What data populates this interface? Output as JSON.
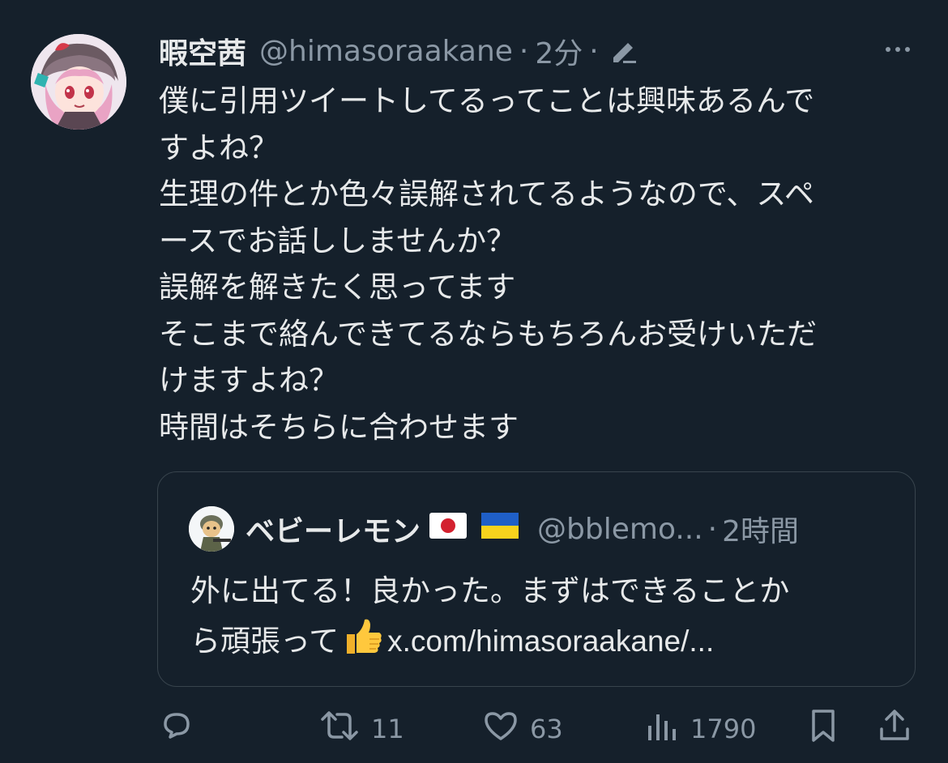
{
  "tweet": {
    "author_name": "暇空茜",
    "handle": "@himasoraakane",
    "separator": "·",
    "time": "2分",
    "separator2": "·",
    "lines": [
      "僕に引用ツイートしてるってことは興味あるんで",
      "すよね？",
      "生理の件とか色々誤解されてるようなので、スペ",
      "ースでお話ししませんか？",
      "誤解を解きたく思ってます",
      "そこまで絡んできてるならもちろんお受けいただ",
      "けますよね？",
      "時間はそちらに合わせます"
    ]
  },
  "quote": {
    "author_name": "ベビーレモン",
    "handle": "@bblemo...",
    "separator": "·",
    "time": "2時間",
    "line1": "外に出てる！良かった。まずはできることか",
    "line2_prefix": "ら頑張って",
    "line2_link": "x.com/himasoraakane/..."
  },
  "actions": {
    "reply_count": "",
    "retweet_count": "11",
    "like_count": "63",
    "views_count": "1790"
  },
  "colors": {
    "background": "#15202b",
    "text": "#e7e9ea",
    "muted": "#8b98a5",
    "border": "#38444d"
  },
  "icons": [
    "avatar",
    "edit-icon",
    "more-icon",
    "japan-flag-icon",
    "ukraine-flag-icon",
    "thumbs-up-icon",
    "reply-icon",
    "retweet-icon",
    "like-icon",
    "views-icon",
    "bookmark-icon",
    "share-icon"
  ]
}
